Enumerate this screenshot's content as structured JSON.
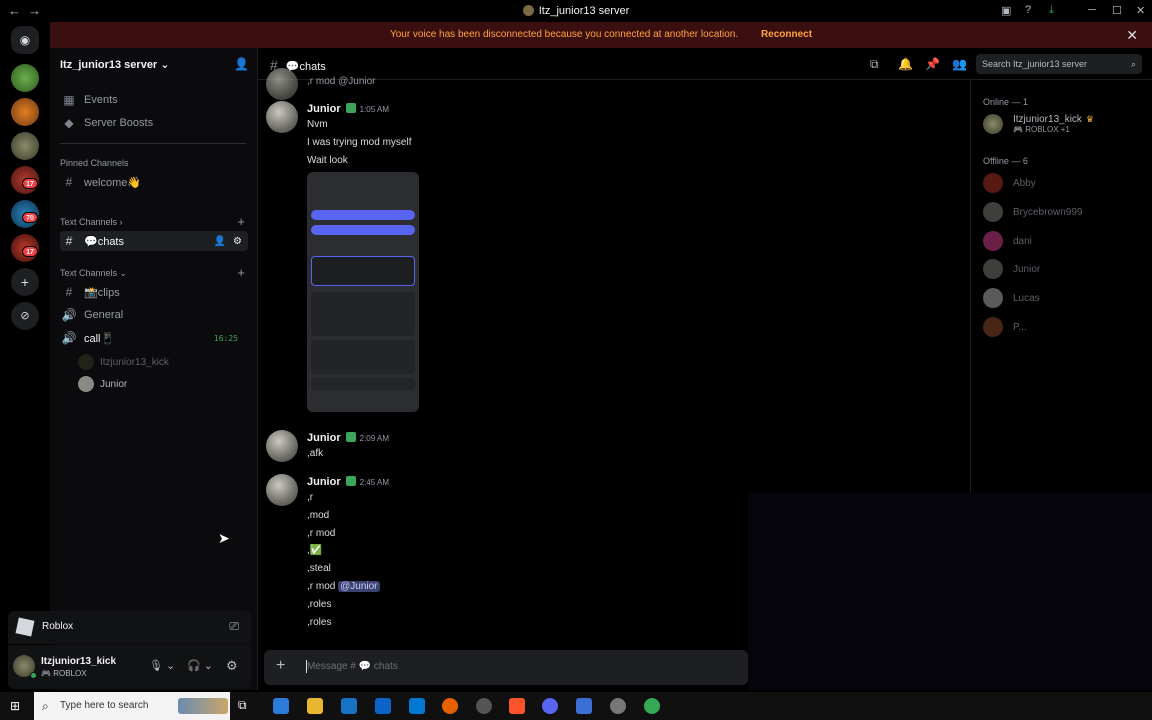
{
  "window": {
    "title": "Itz_junior13 server"
  },
  "banner": {
    "text": "Your voice has been disconnected because you connected at another location.",
    "reconnect": "Reconnect"
  },
  "rail": {
    "badges": [
      "17",
      "70",
      "17"
    ]
  },
  "sidebar": {
    "server_name": "Itz_junior13 server",
    "events": "Events",
    "boosts": "Server Boosts",
    "pinned_header": "Pinned Channels",
    "welcome": "welcome👋",
    "text_header_1": "Text Channels",
    "chats": "💬chats",
    "text_header_2": "Text Channels",
    "clips": "📸clips",
    "general": "General",
    "call": "call📱",
    "call_time": "16:25",
    "voice_users": [
      "Itzjunior13_kick",
      "Junior"
    ]
  },
  "activity": {
    "name": "Roblox"
  },
  "user": {
    "name": "Itzjunior13_kick",
    "status": "ROBLOX"
  },
  "header": {
    "channel": "💬chats",
    "search_placeholder": "Search Itz_junior13 server"
  },
  "messages": {
    "top_cut": ",r mod @Junior",
    "groups": [
      {
        "author": "Junior",
        "time": "1:05 AM",
        "lines": [
          "Nvm",
          "I was trying mod myself",
          "Wait look"
        ]
      },
      {
        "author": "Junior",
        "time": "2:09 AM",
        "lines": [
          ",afk"
        ]
      },
      {
        "author": "Junior",
        "time": "2:45 AM",
        "lines": [
          ",r",
          ",mod",
          ",r mod",
          ",✅",
          ",steal",
          ",r mod",
          ",roles",
          ",roles"
        ],
        "mention": "@Junior"
      }
    ]
  },
  "composer": {
    "placeholder": "Message # 💬 chats"
  },
  "members": {
    "online_header": "Online — 1",
    "online": [
      {
        "name": "Itzjunior13_kick",
        "status": "ROBLOX +1"
      }
    ],
    "offline_header": "Offline — 6",
    "offline": [
      "Abby",
      "Brycebrown999",
      "dani",
      "Junior",
      "Lucas",
      "P..."
    ]
  },
  "taskbar": {
    "search": "Type here to search"
  }
}
